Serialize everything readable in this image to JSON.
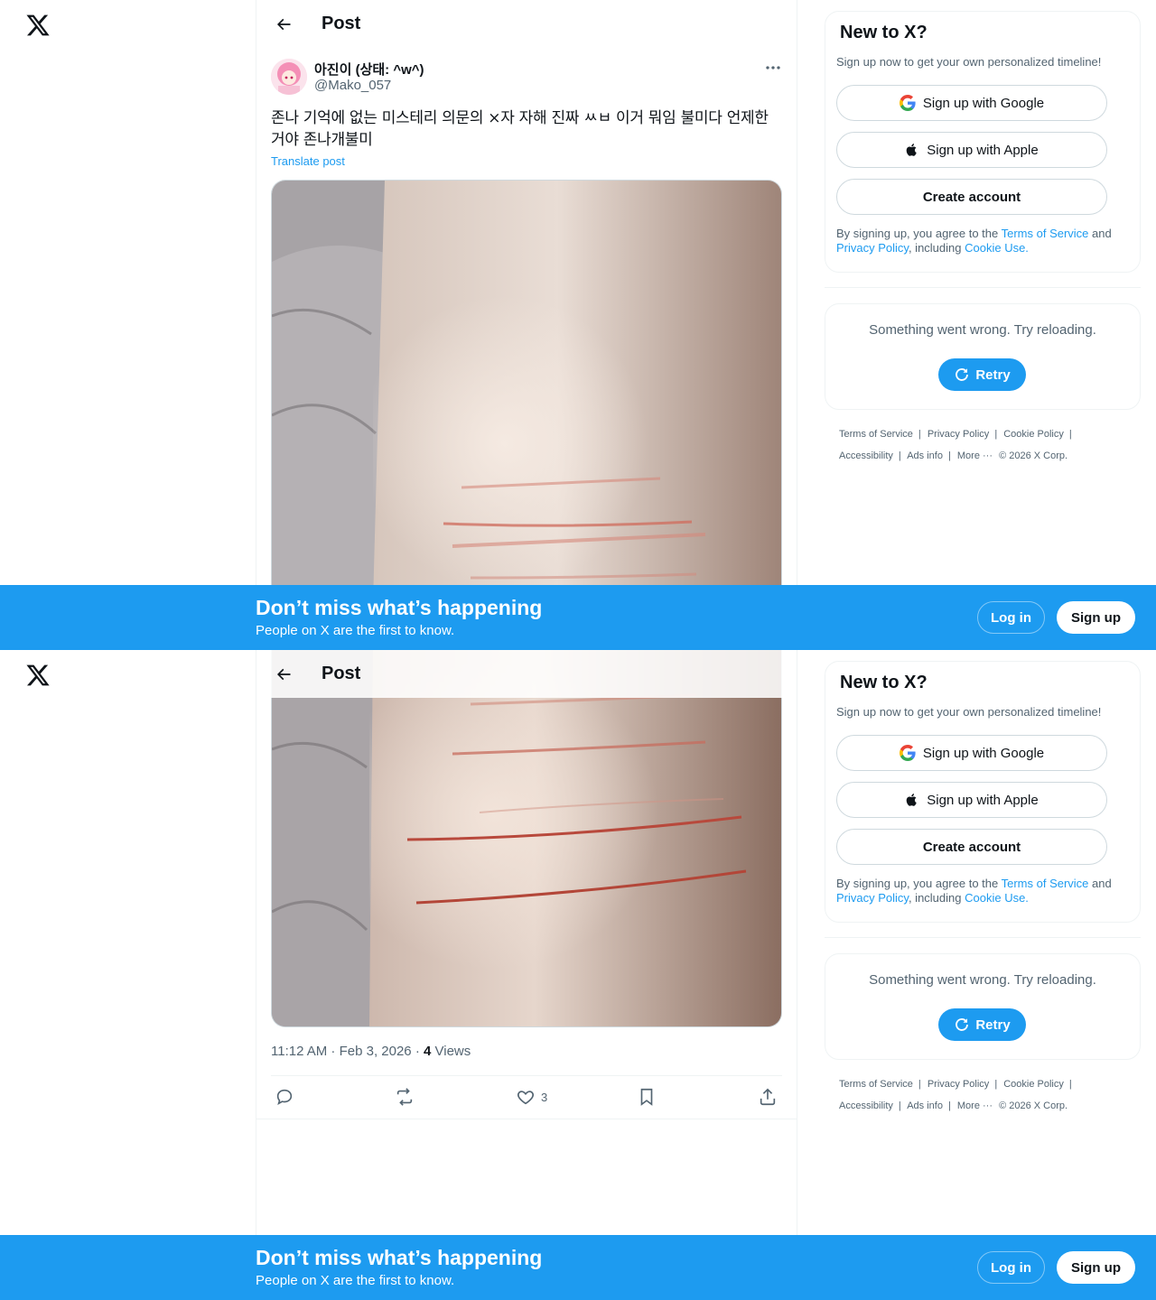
{
  "header": {
    "title": "Post"
  },
  "post": {
    "display_name": "아진이 (상태: ^w^)",
    "handle": "@Mako_057",
    "text": "존나 기억에 없는 미스테리 의문의 ×자 자해 진짜 ㅆㅂ 이거 뭐임 불미다 언제한거야 존나개불미",
    "translate_label": "Translate post",
    "time": "11:12 AM · Feb 3, 2026",
    "views_count": "4",
    "views_label": "Views",
    "like_count": "3"
  },
  "signup_card": {
    "title": "New to X?",
    "subtitle": "Sign up now to get your own personalized timeline!",
    "google_label": "Sign up with Google",
    "apple_label": "Sign up with Apple",
    "create_label": "Create account",
    "legal_prefix": "By signing up, you agree to the ",
    "terms_link": "Terms of Service",
    "legal_and": " and ",
    "privacy_link": "Privacy Policy",
    "legal_including": ", including ",
    "cookie_link": "Cookie Use."
  },
  "error_card": {
    "message": "Something went wrong. Try reloading.",
    "retry_label": "Retry"
  },
  "footer": {
    "terms": "Terms of Service",
    "privacy": "Privacy Policy",
    "cookie": "Cookie Policy",
    "accessibility": "Accessibility",
    "ads": "Ads info",
    "more": "More ···",
    "copyright": "© 2026 X Corp."
  },
  "banner": {
    "title": "Don’t miss what’s happening",
    "subtitle": "People on X are the first to know.",
    "login_label": "Log in",
    "signup_label": "Sign up"
  },
  "colors": {
    "accent": "#1d9bf0",
    "text": "#0f1419",
    "muted": "#536471"
  }
}
